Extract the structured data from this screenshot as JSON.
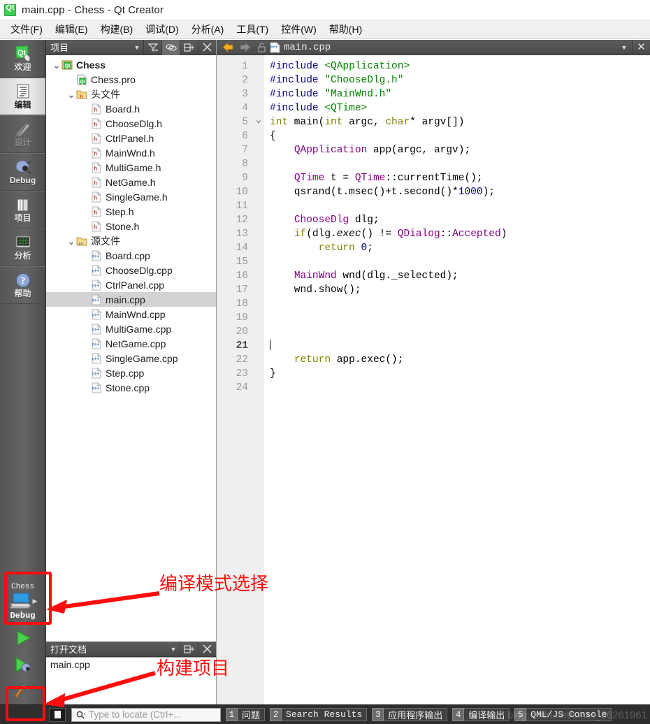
{
  "window": {
    "title": "main.cpp - Chess - Qt Creator",
    "app_icon": "qt-logo-icon"
  },
  "menubar": {
    "items": [
      {
        "label": "文件(F)"
      },
      {
        "label": "编辑(E)"
      },
      {
        "label": "构建(B)"
      },
      {
        "label": "调试(D)"
      },
      {
        "label": "分析(A)"
      },
      {
        "label": "工具(T)"
      },
      {
        "label": "控件(W)"
      },
      {
        "label": "帮助(H)"
      }
    ]
  },
  "modebar": {
    "items": [
      {
        "label": "欢迎",
        "icon": "qt-welcome-icon",
        "state": "normal"
      },
      {
        "label": "编辑",
        "icon": "document-edit-icon",
        "state": "active"
      },
      {
        "label": "设计",
        "icon": "ruler-pencil-icon",
        "state": "disabled"
      },
      {
        "label": "Debug",
        "icon": "bug-icon",
        "state": "normal"
      },
      {
        "label": "项目",
        "icon": "books-icon",
        "state": "normal"
      },
      {
        "label": "分析",
        "icon": "oscilloscope-icon",
        "state": "normal"
      },
      {
        "label": "帮助",
        "icon": "question-mark-icon",
        "state": "normal"
      }
    ],
    "kit_selector": {
      "project": "Chess",
      "build_config": "Debug",
      "icon": "computer-monitor-icon"
    },
    "run_button": {
      "icon": "play-triangle-icon"
    },
    "debug_button": {
      "icon": "play-bug-icon"
    },
    "build_button": {
      "icon": "hammer-icon"
    }
  },
  "project_dock": {
    "title": "项目",
    "tools": [
      "filter-icon",
      "link-sync-icon",
      "split-icon",
      "close-icon"
    ],
    "tree": [
      {
        "label": "Chess",
        "icon": "qt-project-icon",
        "depth": 0,
        "twisty": "v",
        "bold": true,
        "selected": false
      },
      {
        "label": "Chess.pro",
        "icon": "qt-pro-file-icon",
        "depth": 1,
        "twisty": "",
        "bold": false,
        "selected": false
      },
      {
        "label": "头文件",
        "icon": "folder-h-icon",
        "depth": 1,
        "twisty": "v",
        "bold": false,
        "selected": false
      },
      {
        "label": "Board.h",
        "icon": "h-file-icon",
        "depth": 2,
        "twisty": "",
        "bold": false,
        "selected": false
      },
      {
        "label": "ChooseDlg.h",
        "icon": "h-file-icon",
        "depth": 2,
        "twisty": "",
        "bold": false,
        "selected": false
      },
      {
        "label": "CtrlPanel.h",
        "icon": "h-file-icon",
        "depth": 2,
        "twisty": "",
        "bold": false,
        "selected": false
      },
      {
        "label": "MainWnd.h",
        "icon": "h-file-icon",
        "depth": 2,
        "twisty": "",
        "bold": false,
        "selected": false
      },
      {
        "label": "MultiGame.h",
        "icon": "h-file-icon",
        "depth": 2,
        "twisty": "",
        "bold": false,
        "selected": false
      },
      {
        "label": "NetGame.h",
        "icon": "h-file-icon",
        "depth": 2,
        "twisty": "",
        "bold": false,
        "selected": false
      },
      {
        "label": "SingleGame.h",
        "icon": "h-file-icon",
        "depth": 2,
        "twisty": "",
        "bold": false,
        "selected": false
      },
      {
        "label": "Step.h",
        "icon": "h-file-icon",
        "depth": 2,
        "twisty": "",
        "bold": false,
        "selected": false
      },
      {
        "label": "Stone.h",
        "icon": "h-file-icon",
        "depth": 2,
        "twisty": "",
        "bold": false,
        "selected": false
      },
      {
        "label": "源文件",
        "icon": "folder-cpp-icon",
        "depth": 1,
        "twisty": "v",
        "bold": false,
        "selected": false
      },
      {
        "label": "Board.cpp",
        "icon": "cpp-file-icon",
        "depth": 2,
        "twisty": "",
        "bold": false,
        "selected": false
      },
      {
        "label": "ChooseDlg.cpp",
        "icon": "cpp-file-icon",
        "depth": 2,
        "twisty": "",
        "bold": false,
        "selected": false
      },
      {
        "label": "CtrlPanel.cpp",
        "icon": "cpp-file-icon",
        "depth": 2,
        "twisty": "",
        "bold": false,
        "selected": false
      },
      {
        "label": "main.cpp",
        "icon": "cpp-file-icon",
        "depth": 2,
        "twisty": "",
        "bold": false,
        "selected": true
      },
      {
        "label": "MainWnd.cpp",
        "icon": "cpp-file-icon",
        "depth": 2,
        "twisty": "",
        "bold": false,
        "selected": false
      },
      {
        "label": "MultiGame.cpp",
        "icon": "cpp-file-icon",
        "depth": 2,
        "twisty": "",
        "bold": false,
        "selected": false
      },
      {
        "label": "NetGame.cpp",
        "icon": "cpp-file-icon",
        "depth": 2,
        "twisty": "",
        "bold": false,
        "selected": false
      },
      {
        "label": "SingleGame.cpp",
        "icon": "cpp-file-icon",
        "depth": 2,
        "twisty": "",
        "bold": false,
        "selected": false
      },
      {
        "label": "Step.cpp",
        "icon": "cpp-file-icon",
        "depth": 2,
        "twisty": "",
        "bold": false,
        "selected": false
      },
      {
        "label": "Stone.cpp",
        "icon": "cpp-file-icon",
        "depth": 2,
        "twisty": "",
        "bold": false,
        "selected": false
      }
    ]
  },
  "opendocs_dock": {
    "title": "打开文档",
    "tools": [
      "split-icon",
      "close-icon"
    ],
    "items": [
      {
        "label": "main.cpp"
      }
    ]
  },
  "editor": {
    "toolbar": {
      "back_icon": "arrow-left-icon",
      "forward_icon": "arrow-right-icon",
      "lock_icon": "unlocked-padlock-icon",
      "file_icon": "cpp-file-icon",
      "filename": "main.cpp",
      "dropdown_icon": "chevron-down-icon",
      "close_icon": "close-icon"
    },
    "current_line": 21,
    "total_lines": 24,
    "fold_markers": {
      "5": "v"
    },
    "lines": [
      {
        "n": 1,
        "tokens": [
          {
            "t": "#include ",
            "c": "pre"
          },
          {
            "t": "<QApplication>",
            "c": "str"
          }
        ]
      },
      {
        "n": 2,
        "tokens": [
          {
            "t": "#include ",
            "c": "pre"
          },
          {
            "t": "\"ChooseDlg.h\"",
            "c": "str"
          }
        ]
      },
      {
        "n": 3,
        "tokens": [
          {
            "t": "#include ",
            "c": "pre"
          },
          {
            "t": "\"MainWnd.h\"",
            "c": "str"
          }
        ]
      },
      {
        "n": 4,
        "tokens": [
          {
            "t": "#include ",
            "c": "pre"
          },
          {
            "t": "<QTime>",
            "c": "str"
          }
        ]
      },
      {
        "n": 5,
        "tokens": [
          {
            "t": "int",
            "c": "kw"
          },
          {
            "t": " main(",
            "c": "txt"
          },
          {
            "t": "int",
            "c": "kw"
          },
          {
            "t": " argc, ",
            "c": "txt"
          },
          {
            "t": "char",
            "c": "kw"
          },
          {
            "t": "* argv[])",
            "c": "txt"
          }
        ]
      },
      {
        "n": 6,
        "tokens": [
          {
            "t": "{",
            "c": "txt"
          }
        ]
      },
      {
        "n": 7,
        "tokens": [
          {
            "t": "    ",
            "c": "txt"
          },
          {
            "t": "QApplication",
            "c": "type"
          },
          {
            "t": " app(argc, argv);",
            "c": "txt"
          }
        ]
      },
      {
        "n": 8,
        "tokens": []
      },
      {
        "n": 9,
        "tokens": [
          {
            "t": "    ",
            "c": "txt"
          },
          {
            "t": "QTime",
            "c": "type"
          },
          {
            "t": " t = ",
            "c": "txt"
          },
          {
            "t": "QTime",
            "c": "type"
          },
          {
            "t": "::currentTime();",
            "c": "txt"
          }
        ]
      },
      {
        "n": 10,
        "tokens": [
          {
            "t": "    qsrand(t.msec()+t.second()*",
            "c": "txt"
          },
          {
            "t": "1000",
            "c": "num"
          },
          {
            "t": ");",
            "c": "txt"
          }
        ]
      },
      {
        "n": 11,
        "tokens": []
      },
      {
        "n": 12,
        "tokens": [
          {
            "t": "    ",
            "c": "txt"
          },
          {
            "t": "ChooseDlg",
            "c": "type"
          },
          {
            "t": " dlg;",
            "c": "txt"
          }
        ]
      },
      {
        "n": 13,
        "tokens": [
          {
            "t": "    ",
            "c": "txt"
          },
          {
            "t": "if",
            "c": "kw"
          },
          {
            "t": "(dlg.",
            "c": "txt"
          },
          {
            "t": "exec",
            "c": "fn"
          },
          {
            "t": "() != ",
            "c": "txt"
          },
          {
            "t": "QDialog",
            "c": "type"
          },
          {
            "t": "::",
            "c": "txt"
          },
          {
            "t": "Accepted",
            "c": "type"
          },
          {
            "t": ")",
            "c": "txt"
          }
        ]
      },
      {
        "n": 14,
        "tokens": [
          {
            "t": "        ",
            "c": "txt"
          },
          {
            "t": "return",
            "c": "kw"
          },
          {
            "t": " ",
            "c": "txt"
          },
          {
            "t": "0",
            "c": "num"
          },
          {
            "t": ";",
            "c": "txt"
          }
        ]
      },
      {
        "n": 15,
        "tokens": []
      },
      {
        "n": 16,
        "tokens": [
          {
            "t": "    ",
            "c": "txt"
          },
          {
            "t": "MainWnd",
            "c": "type"
          },
          {
            "t": " wnd(dlg._selected);",
            "c": "txt"
          }
        ]
      },
      {
        "n": 17,
        "tokens": [
          {
            "t": "    wnd.show();",
            "c": "txt"
          }
        ]
      },
      {
        "n": 18,
        "tokens": []
      },
      {
        "n": 19,
        "tokens": []
      },
      {
        "n": 20,
        "tokens": []
      },
      {
        "n": 21,
        "tokens": [],
        "caret": true
      },
      {
        "n": 22,
        "tokens": [
          {
            "t": "    ",
            "c": "txt"
          },
          {
            "t": "return",
            "c": "kw"
          },
          {
            "t": " app.exec();",
            "c": "txt"
          }
        ]
      },
      {
        "n": 23,
        "tokens": [
          {
            "t": "}",
            "c": "txt"
          }
        ]
      },
      {
        "n": 24,
        "tokens": []
      }
    ]
  },
  "statusbar": {
    "sidebar_toggle_icon": "sidebar-toggle-icon",
    "locator": {
      "icon": "search-icon",
      "placeholder": "Type to locate (Ctrl+...",
      "value": ""
    },
    "panes": [
      {
        "num": "1",
        "label": "问题",
        "mono": false
      },
      {
        "num": "2",
        "label": "Search Results",
        "mono": true
      },
      {
        "num": "3",
        "label": "应用程序输出",
        "mono": false
      },
      {
        "num": "4",
        "label": "编译输出",
        "mono": false
      },
      {
        "num": "5",
        "label": "QML/JS Console",
        "mono": true
      }
    ],
    "watermark": "blog.csdn.net/sinat_36261961"
  },
  "annotations": {
    "compile_mode": {
      "text": "编译模式选择"
    },
    "build_project": {
      "text": "构建项目"
    },
    "accent_color": "#fb0d0d"
  }
}
